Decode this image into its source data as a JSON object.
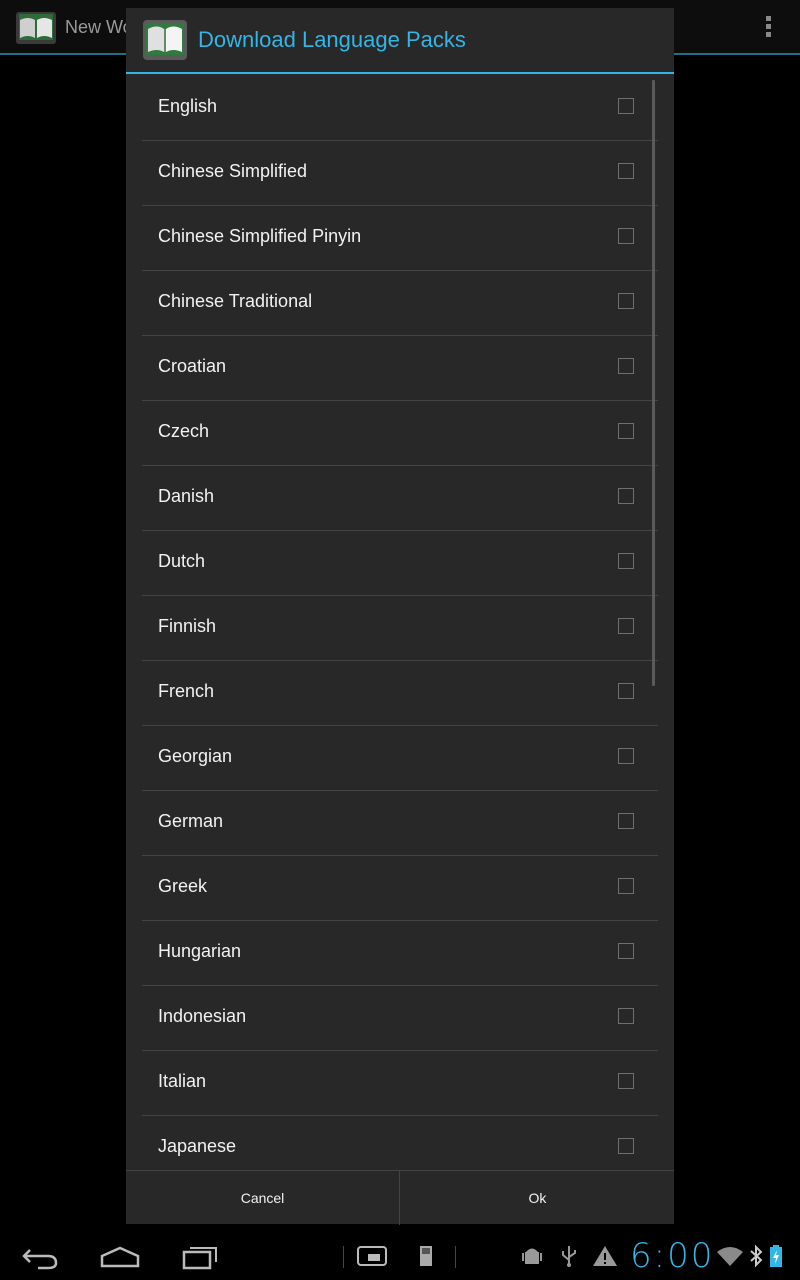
{
  "background_app": {
    "title": "New Wo"
  },
  "dialog": {
    "title": "Download Language Packs",
    "languages": [
      {
        "label": "English",
        "checked": false
      },
      {
        "label": "Chinese Simplified",
        "checked": false
      },
      {
        "label": "Chinese Simplified Pinyin",
        "checked": false
      },
      {
        "label": "Chinese Traditional",
        "checked": false
      },
      {
        "label": "Croatian",
        "checked": false
      },
      {
        "label": "Czech",
        "checked": false
      },
      {
        "label": "Danish",
        "checked": false
      },
      {
        "label": "Dutch",
        "checked": false
      },
      {
        "label": "Finnish",
        "checked": false
      },
      {
        "label": "French",
        "checked": false
      },
      {
        "label": "Georgian",
        "checked": false
      },
      {
        "label": "German",
        "checked": false
      },
      {
        "label": "Greek",
        "checked": false
      },
      {
        "label": "Hungarian",
        "checked": false
      },
      {
        "label": "Indonesian",
        "checked": false
      },
      {
        "label": "Italian",
        "checked": false
      },
      {
        "label": "Japanese",
        "checked": false
      }
    ],
    "buttons": {
      "cancel": "Cancel",
      "ok": "Ok"
    }
  },
  "system_bar": {
    "clock": "6:00",
    "icons": [
      "back-icon",
      "home-icon",
      "recent-apps-icon",
      "screenshot-icon",
      "sd-card-icon",
      "android-debug-icon",
      "usb-icon",
      "warning-icon",
      "wifi-icon",
      "bluetooth-icon",
      "battery-charging-icon"
    ]
  },
  "colors": {
    "accent": "#33b5e5",
    "dialog_bg": "#282828",
    "divider": "#444444",
    "text": "#f2f2f2"
  }
}
